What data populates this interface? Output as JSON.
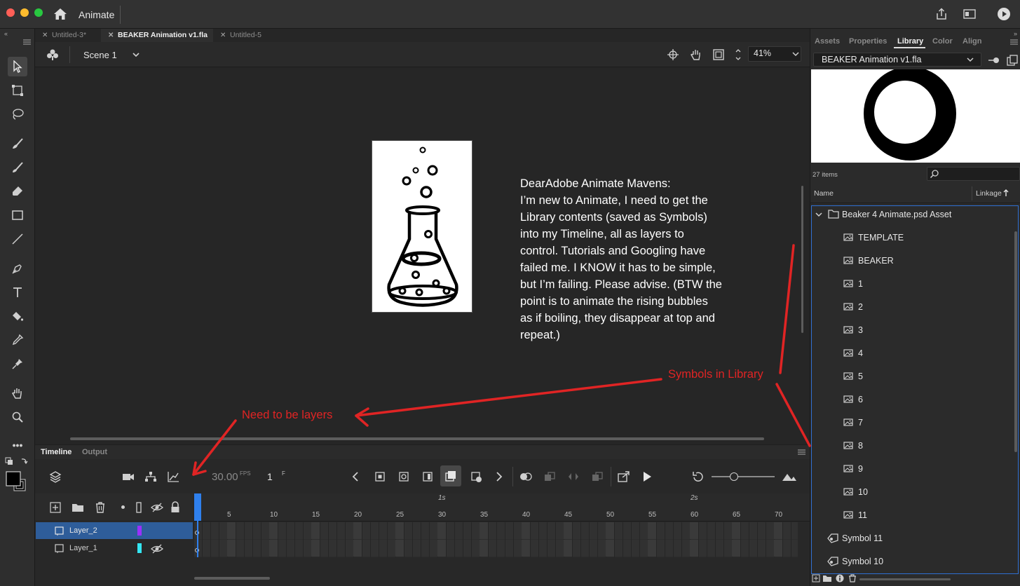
{
  "app": {
    "name": "Animate"
  },
  "doc_tabs": [
    {
      "label": "Untitled-3*",
      "active": false
    },
    {
      "label": "BEAKER Animation v1.fla",
      "active": true
    },
    {
      "label": "Untitled-5",
      "active": false
    }
  ],
  "scene": {
    "name": "Scene 1",
    "zoom": "41%"
  },
  "stage": {
    "message_lines": [
      "DearAdobe Animate Mavens:",
      "I’m new to Animate, I need to get the",
      "Library contents (saved as Symbols)",
      "into my Timeline, all as layers to",
      "control. Tutorials and Googling have",
      "failed me. I KNOW it has to be simple,",
      "but I’m failing. Please advise. (BTW the",
      "point is to animate the rising bubbles",
      "as if boiling, they disappear at top and",
      "repeat.)"
    ]
  },
  "annotations": {
    "symbols": "Symbols in Library",
    "layers": "Need to be layers",
    "color": "#e02424"
  },
  "timeline": {
    "tabs": [
      "Timeline",
      "Output"
    ],
    "fps": "30.00",
    "fps_unit": "FPS",
    "frame": "1",
    "frame_unit": "F",
    "seconds": [
      "1s",
      "2s"
    ],
    "ticks": [
      "5",
      "10",
      "15",
      "20",
      "25",
      "30",
      "35",
      "40",
      "45",
      "50",
      "55",
      "60",
      "65",
      "70"
    ],
    "layers": [
      {
        "name": "Layer_2",
        "color": "#9b30ff",
        "selected": true
      },
      {
        "name": "Layer_1",
        "color": "#33e6f2",
        "selected": false
      }
    ]
  },
  "right_panel": {
    "tabs": [
      {
        "label": "Assets",
        "active": false
      },
      {
        "label": "Properties",
        "active": false
      },
      {
        "label": "Library",
        "active": true
      },
      {
        "label": "Color",
        "active": false
      },
      {
        "label": "Align",
        "active": false
      }
    ],
    "document": "BEAKER Animation v1.fla",
    "count": "27 items",
    "col_name": "Name",
    "col_linkage": "Linkage",
    "folder": "Beaker 4 Animate.psd Asset",
    "bitmaps": [
      "TEMPLATE",
      "BEAKER",
      "1",
      "2",
      "3",
      "4",
      "5",
      "6",
      "7",
      "8",
      "9",
      "10",
      "11"
    ],
    "symbols": [
      "Symbol 11",
      "Symbol 10"
    ]
  },
  "colors": {
    "accent": "#2f80ed",
    "stage_bg": "#262626",
    "panel_bg": "#2b2b2b"
  }
}
